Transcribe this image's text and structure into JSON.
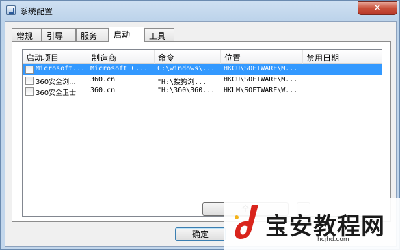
{
  "window": {
    "title": "系统配置",
    "close_glyph": "✕"
  },
  "tabs": [
    {
      "label": "常规"
    },
    {
      "label": "引导"
    },
    {
      "label": "服务"
    },
    {
      "label": "启动",
      "active": true
    },
    {
      "label": "工具"
    }
  ],
  "startup_list": {
    "columns": [
      "启动项目",
      "制造商",
      "命令",
      "位置",
      "禁用日期"
    ],
    "rows": [
      {
        "item": "Microsoft...",
        "manufacturer": "Microsoft C...",
        "command": "C:\\windows\\...",
        "location": "HKCU\\SOFTWARE\\M...",
        "disabled_date": "",
        "selected": true
      },
      {
        "item": "360安全浏...",
        "manufacturer": "360.cn",
        "command": "\"H:\\搜狗浏...",
        "location": "HKCU\\SOFTWARE\\M...",
        "disabled_date": ""
      },
      {
        "item": "360安全卫士",
        "manufacturer": "360.cn",
        "command": "\"H:\\360\\360...",
        "location": "HKLM\\SOFTWARE\\W...",
        "disabled_date": ""
      }
    ]
  },
  "buttons": {
    "enable_all": "全",
    "ok": "确定"
  },
  "watermark": {
    "title": "宝安教程网",
    "url": "hcjhd.com"
  },
  "colors": {
    "selection": "#3399ff",
    "close_red": "#c9503a",
    "watermark_red": "#d9241c"
  }
}
